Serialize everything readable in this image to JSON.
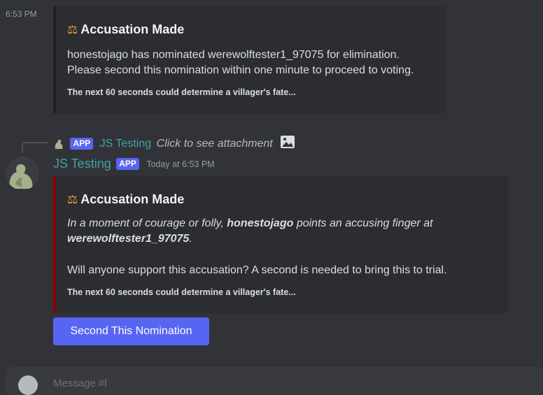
{
  "message1": {
    "timestamp": "6:53 PM",
    "embed": {
      "title_icon": "scales-icon",
      "title": "Accusation Made",
      "line1": "honestojago has nominated werewolftester1_97075 for elimination.",
      "line2": "Please second this nomination within one minute to proceed to voting.",
      "footer": "The next 60 seconds could determine a villager's fate..."
    }
  },
  "reply": {
    "badge": "APP",
    "author": "JS Testing",
    "link_text": "Click to see attachment"
  },
  "message2": {
    "author": "JS Testing",
    "badge": "APP",
    "timestamp": "Today at 6:53 PM",
    "embed": {
      "accent_color": "#8b0000",
      "title": "Accusation Made",
      "desc_prefix": "In a moment of courage or folly,",
      "accuser": "honestojago",
      "desc_middle": "points an accusing finger at",
      "accused": "werewolftester1_97075",
      "desc_end": ".",
      "line3": "Will anyone support this accusation? A second is needed to bring this to trial.",
      "footer": "The next 60 seconds could determine a villager's fate..."
    },
    "button_label": "Second This Nomination"
  },
  "composer": {
    "placeholder": "Message #l"
  },
  "colors": {
    "background": "#323339",
    "embed_background": "#2b2d31",
    "blurple": "#5865f2",
    "bot_name": "#3ea6a0"
  }
}
